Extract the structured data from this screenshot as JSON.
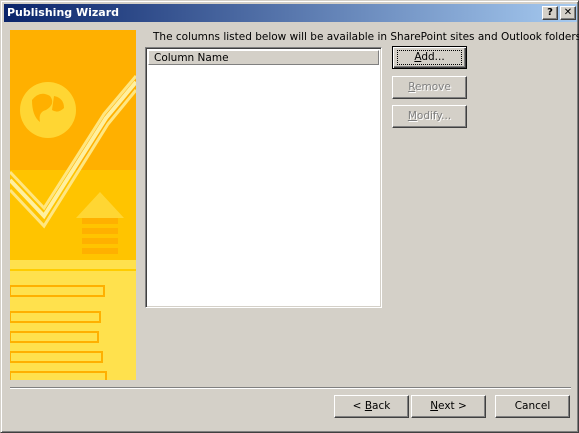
{
  "window": {
    "title": "Publishing Wizard",
    "help_glyph": "?",
    "close_glyph": "✕"
  },
  "instructions": "The columns listed below will be available in SharePoint sites and Outlook folders.",
  "list": {
    "column_header": "Column Name",
    "rows": []
  },
  "side_buttons": {
    "add": {
      "pre": "",
      "key": "A",
      "post": "dd...",
      "enabled": true
    },
    "remove": {
      "pre": "",
      "key": "R",
      "post": "emove",
      "enabled": false
    },
    "modify": {
      "pre": "",
      "key": "M",
      "post": "odify...",
      "enabled": false
    }
  },
  "nav_buttons": {
    "back": {
      "pre": "< ",
      "key": "B",
      "post": "ack"
    },
    "next": {
      "pre": "",
      "key": "N",
      "post": "ext >"
    },
    "cancel": {
      "label": "Cancel"
    }
  },
  "colors": {
    "title_start": "#0a246a",
    "title_end": "#a6caf0",
    "face": "#d4d0c8",
    "banner_yellow": "#ffcc00",
    "banner_orange": "#ffb300"
  }
}
